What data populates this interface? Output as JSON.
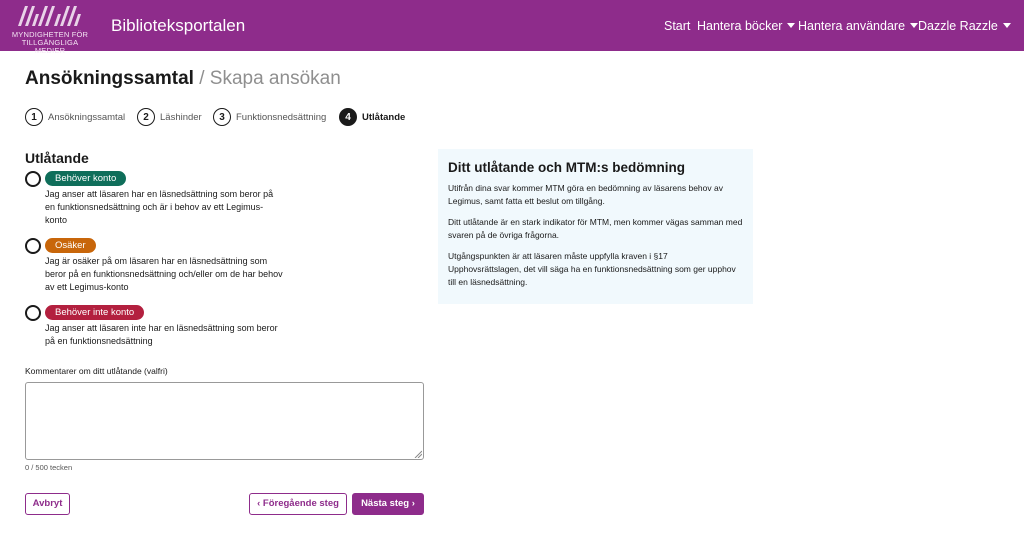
{
  "navbar": {
    "logo_line1": "MYNDIGHETEN FÖR",
    "logo_line2": "TILLGÄNGLIGA MEDIER",
    "brand": "Biblioteksportalen",
    "items": [
      {
        "label": "Start"
      },
      {
        "label": "Hantera böcker"
      },
      {
        "label": "Hantera användare"
      },
      {
        "label": "Dazzle Razzle"
      }
    ],
    "color": "#8e2c8b"
  },
  "page": {
    "title": "Ansökningssamtal",
    "separator": " / ",
    "subtitle": "Skapa ansökan"
  },
  "stepper": [
    {
      "num": "1",
      "label": "Ansökningssamtal"
    },
    {
      "num": "2",
      "label": "Läshinder"
    },
    {
      "num": "3",
      "label": "Funktionsnedsättning"
    },
    {
      "num": "4",
      "label": "Utlåtande"
    }
  ],
  "form": {
    "section_title": "Utlåtande",
    "options": [
      {
        "badge": "Behöver konto",
        "color": "#0f6e5a",
        "desc": "Jag anser att läsaren har en läsnedsättning som beror på en funktionsnedsättning och är i behov av ett Legimus-konto"
      },
      {
        "badge": "Osäker",
        "color": "#c8660a",
        "desc": "Jag är osäker på om läsaren har en läsnedsättning som beror på en funktionsnedsättning och/eller om de har behov av ett Legimus-konto"
      },
      {
        "badge": "Behöver inte konto",
        "color": "#b3203f",
        "desc": "Jag anser att läsaren inte har en läsnedsättning som beror på en funktionsnedsättning"
      }
    ],
    "comment_label": "Kommentarer om ditt utlåtande (valfri)",
    "comment_value": "",
    "char_count": "0 / 500 tecken"
  },
  "buttons": {
    "cancel": "Avbryt",
    "previous": "Föregående steg",
    "next": "Nästa steg"
  },
  "info": {
    "title": "Ditt utlåtande och MTM:s bedömning",
    "paragraphs": [
      "Utifrån dina svar kommer MTM göra en bedömning av läsarens behov av Legimus, samt fatta ett beslut om tillgång.",
      "Ditt utlåtande är en stark indikator för MTM, men kommer vägas samman med svaren på de övriga frågorna.",
      "Utgångspunkten är att läsaren måste uppfylla kraven i §17 Upphovsrättslagen, det vill säga ha en funktionsnedsättning som ger upphov till en läsnedsättning."
    ]
  }
}
